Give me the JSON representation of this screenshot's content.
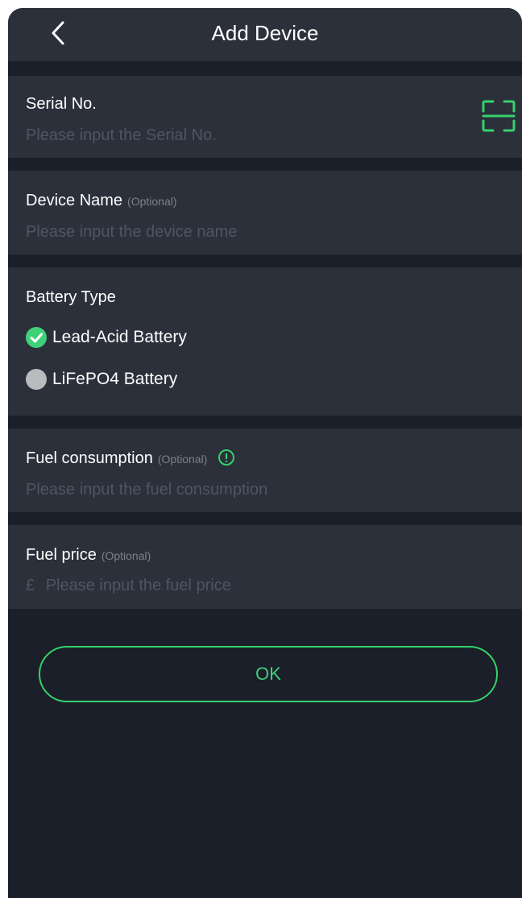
{
  "header": {
    "title": "Add Device"
  },
  "serial": {
    "label": "Serial No.",
    "placeholder": "Please input the Serial No."
  },
  "device_name": {
    "label": "Device Name",
    "optional": "(Optional)",
    "placeholder": "Please input the device name"
  },
  "battery": {
    "label": "Battery Type",
    "options": [
      {
        "label": "Lead-Acid Battery",
        "selected": true
      },
      {
        "label": "LiFePO4 Battery",
        "selected": false
      }
    ]
  },
  "fuel_consumption": {
    "label": "Fuel consumption",
    "optional": "(Optional)",
    "placeholder": "Please input the fuel consumption"
  },
  "fuel_price": {
    "label": "Fuel price",
    "optional": "(Optional)",
    "currency": "£",
    "placeholder": "Please input the fuel price"
  },
  "ok_label": "OK",
  "colors": {
    "accent": "#3fd17a",
    "panel": "#2b303b",
    "background": "#1b1f29"
  }
}
